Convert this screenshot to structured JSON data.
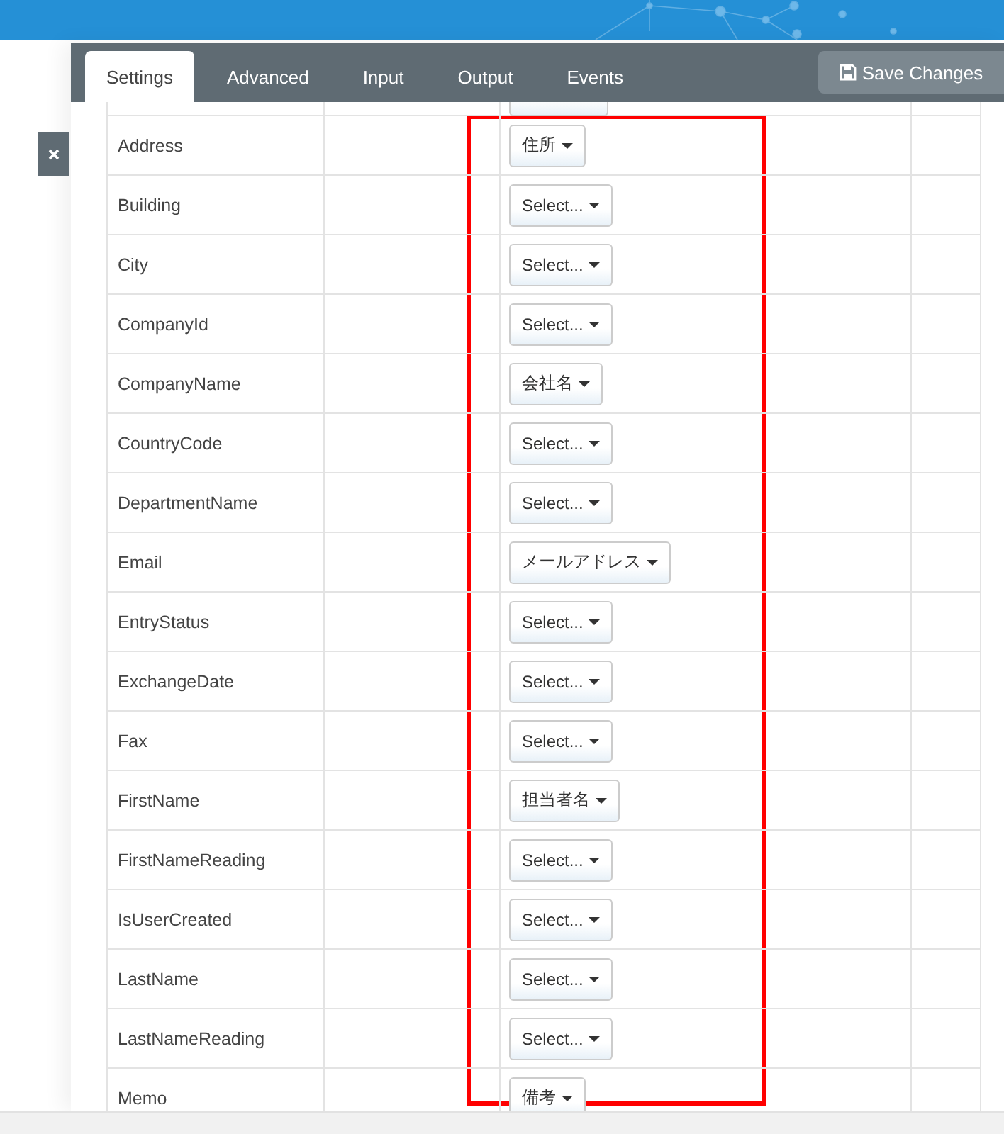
{
  "tabs": [
    {
      "label": "Settings",
      "selected": true
    },
    {
      "label": "Advanced",
      "selected": false
    },
    {
      "label": "Input",
      "selected": false
    },
    {
      "label": "Output",
      "selected": false
    },
    {
      "label": "Events",
      "selected": false
    }
  ],
  "save_button": {
    "label": "Save Changes"
  },
  "rows": [
    {
      "field": "Address",
      "mapping": "住所"
    },
    {
      "field": "Building",
      "mapping": "Select..."
    },
    {
      "field": "City",
      "mapping": "Select..."
    },
    {
      "field": "CompanyId",
      "mapping": "Select..."
    },
    {
      "field": "CompanyName",
      "mapping": "会社名"
    },
    {
      "field": "CountryCode",
      "mapping": "Select..."
    },
    {
      "field": "DepartmentName",
      "mapping": "Select..."
    },
    {
      "field": "Email",
      "mapping": "メールアドレス"
    },
    {
      "field": "EntryStatus",
      "mapping": "Select..."
    },
    {
      "field": "ExchangeDate",
      "mapping": "Select..."
    },
    {
      "field": "Fax",
      "mapping": "Select..."
    },
    {
      "field": "FirstName",
      "mapping": "担当者名"
    },
    {
      "field": "FirstNameReading",
      "mapping": "Select..."
    },
    {
      "field": "IsUserCreated",
      "mapping": "Select..."
    },
    {
      "field": "LastName",
      "mapping": "Select..."
    },
    {
      "field": "LastNameReading",
      "mapping": "Select..."
    },
    {
      "field": "Memo",
      "mapping": "備考"
    }
  ]
}
